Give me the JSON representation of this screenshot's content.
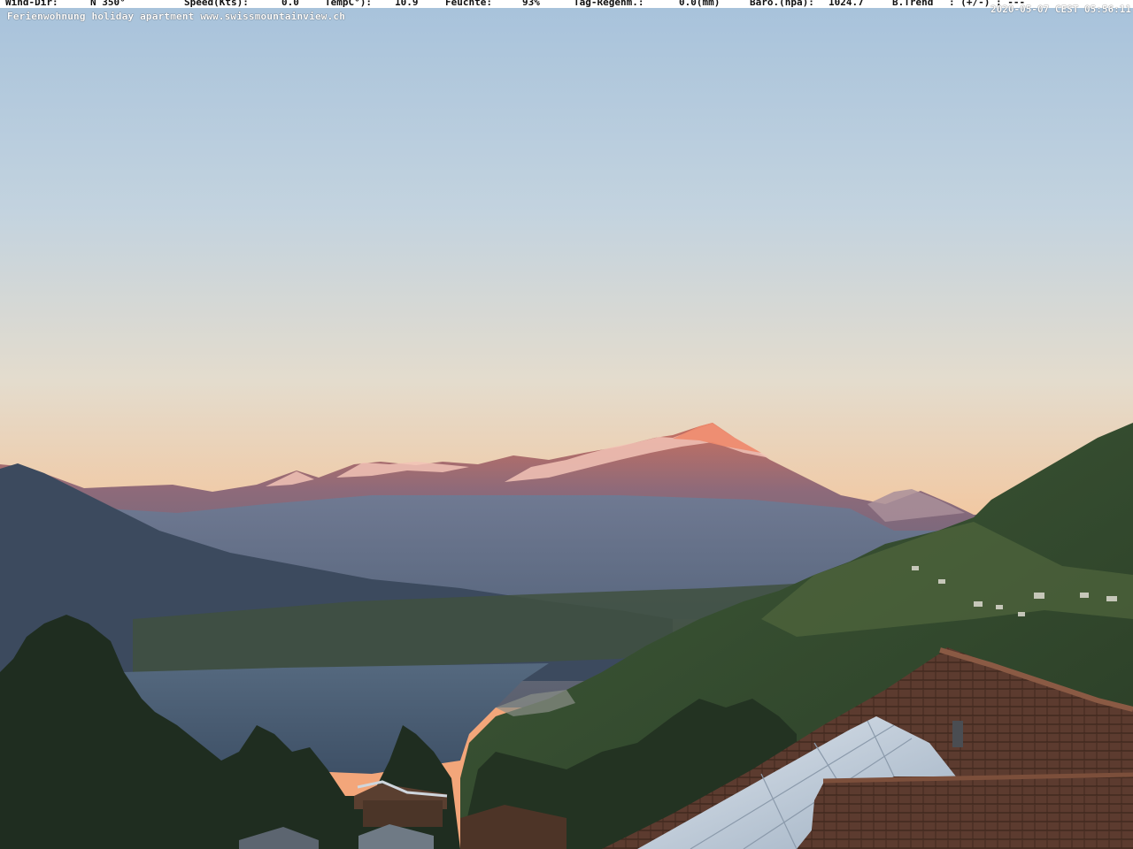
{
  "weather_bar": {
    "wind_dir_label": "Wind-Dir:",
    "wind_dir_value": "N 350°",
    "speed_label": "Speed(Kts):",
    "speed_value": "0.0",
    "temp_label": "TempC°):",
    "temp_value": "10.9",
    "humidity_label": "Feuchte:",
    "humidity_value": "93%",
    "rain_label": "Tag-Regenm.:",
    "rain_value": "0.0(mm)",
    "baro_label": "Baro.(hpa):",
    "baro_value": "1024.7",
    "trend_label": "B.Trend",
    "trend_value": ": (+/-) : ---"
  },
  "overlay": {
    "credit": "Ferienwohnung holiday apartment www.swissmountainview.ch",
    "timestamp": "2020-05-07 CEST 05:56:11"
  },
  "colors": {
    "sky_top": "#a9c4dc",
    "sky_mid": "#e6dccb",
    "sky_horizon": "#f4a070",
    "alpenglow": "#e8826a",
    "lake": "#4f6680",
    "forest": "#2c3f2a"
  }
}
